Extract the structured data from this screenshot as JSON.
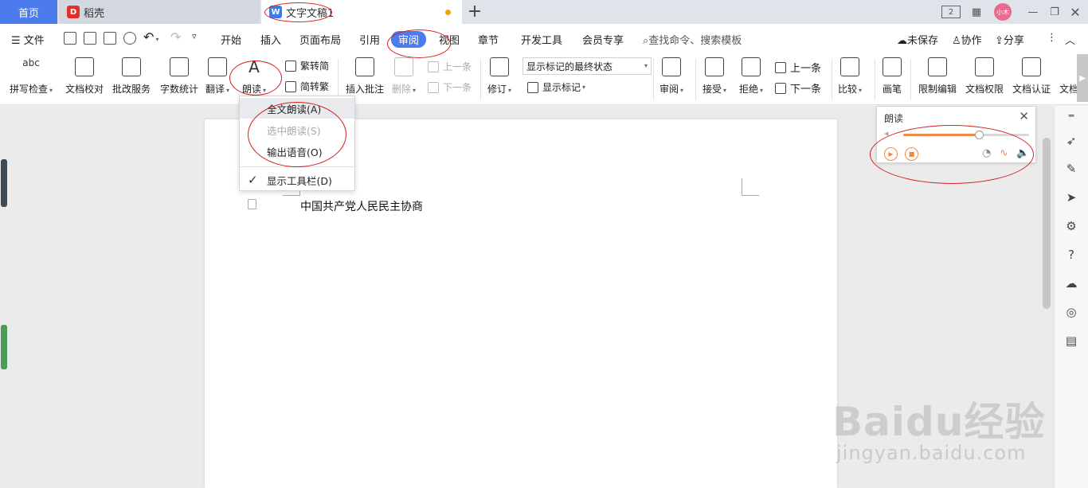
{
  "tabs": {
    "home": "首页",
    "daoke": "稻壳",
    "doc": "文字文稿1",
    "new_tab": "+"
  },
  "titlebar": {
    "layout_badge": "2",
    "avatar_text": "小木"
  },
  "menu": {
    "file": "文件",
    "items": [
      "开始",
      "插入",
      "页面布局",
      "引用",
      "审阅",
      "视图",
      "章节",
      "开发工具",
      "会员专享"
    ],
    "search_placeholder": "查找命令、搜索模板",
    "unsaved": "未保存",
    "collab": "协作",
    "share": "分享"
  },
  "ribbon": {
    "spellcheck": "拼写检查",
    "proofread": "文档校对",
    "review_service": "批改服务",
    "word_count": "字数统计",
    "translate": "翻译",
    "read_aloud": "朗读",
    "trad_convert": "繁转简",
    "simp_convert": "简转繁",
    "insert_comment": "插入批注",
    "delete": "删除",
    "prev_comment": "上一条",
    "next_comment": "下一条",
    "revise": "修订",
    "markup_state": "显示标记的最终状态",
    "show_markup": "显示标记",
    "review": "审阅",
    "accept": "接受",
    "reject": "拒绝",
    "prev_change": "上一条",
    "next_change": "下一条",
    "compare": "比较",
    "pen": "画笔",
    "restrict_edit": "限制编辑",
    "doc_permission": "文档权限",
    "doc_cert": "文档认证",
    "doc_more": "文档"
  },
  "dropdown": {
    "read_all": "全文朗读(A)",
    "read_selection": "选中朗读(S)",
    "export_audio": "输出语音(O)",
    "show_toolbar": "显示工具栏(D)"
  },
  "read_panel": {
    "title": "朗读",
    "volume_level": 0.6
  },
  "document": {
    "text": "中国共产党人民民主协商"
  },
  "watermark": {
    "line1": "Baidu经验",
    "line2": "jingyan.baidu.com"
  },
  "colors": {
    "accent": "#4b7bec",
    "annotation": "#d42020",
    "read_accent": "#f08a4b"
  }
}
